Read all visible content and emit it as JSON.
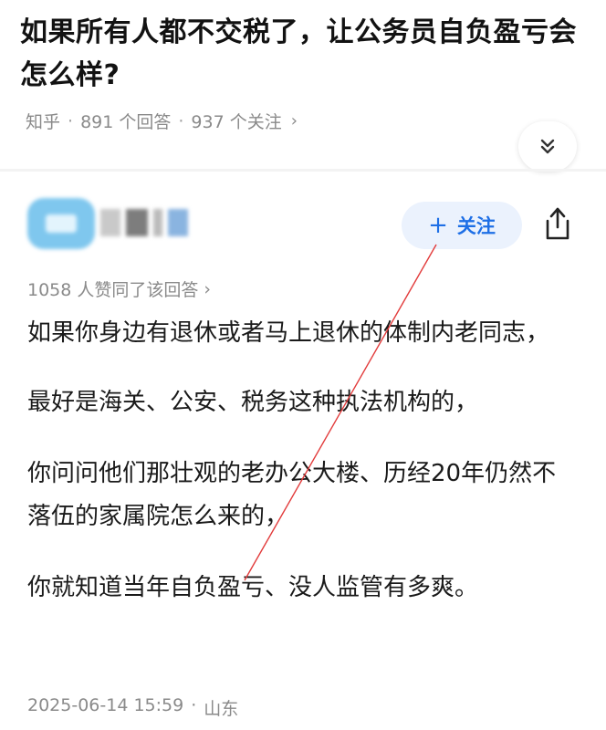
{
  "question": {
    "title": "如果所有人都不交税了，让公务员自负盈亏会怎么样?",
    "source": "知乎",
    "answers_count": "891 个回答",
    "followers_count": "937 个关注",
    "separator": "·",
    "more_chevron": "›"
  },
  "answer": {
    "follow_plus": "+",
    "follow_label": "关注",
    "upvote_summary": "1058 人赞同了该回答",
    "upvote_chevron": "›",
    "paragraphs": [
      "如果你身边有退休或者马上退休的体制内老同志，",
      "最好是海关、公安、税务这种执法机构的，",
      "你问问他们那壮观的老办公大楼、历经20年仍然不落伍的家属院怎么来的，",
      "你就知道当年自负盈亏、没人监管有多爽。"
    ],
    "timestamp": "2025-06-14 15:59",
    "location_separator": "·",
    "location": "山东"
  },
  "icons": {
    "expand": "chevron-double-down-icon",
    "share": "share-icon",
    "follow": "plus-icon"
  },
  "colors": {
    "follow_text": "#1e6fe6",
    "follow_bg": "#ebf2fd",
    "meta_text": "#8a8a8a",
    "annotation_line": "#e23b3b"
  }
}
